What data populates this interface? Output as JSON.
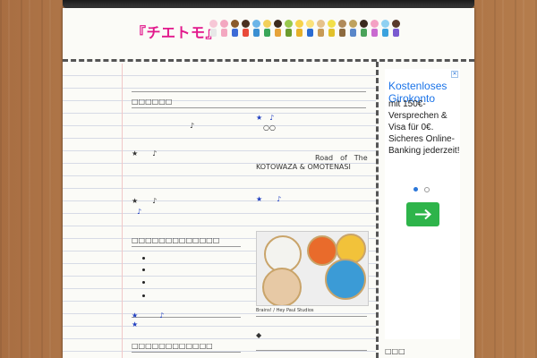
{
  "header": {
    "logo_text": "『チエトモ』"
  },
  "main": {
    "section1_heading": "□□□□□□",
    "notes_left": [
      {
        "text": "♪"
      },
      {
        "text": "★　　♪"
      },
      {
        "text": "★　　♪"
      },
      {
        "text": "♪"
      }
    ],
    "notes_right": [
      {
        "text": "★　♪"
      },
      {
        "text": "○○"
      },
      {
        "text": "Road　of　The"
      },
      {
        "text": "KOTOWAZA & OMOTENASI"
      },
      {
        "text": "★　　♪"
      }
    ],
    "section2_heading": "□□□□□□□□□□□□□",
    "bullet_count": 4,
    "section2_notes": [
      {
        "text": "★　　　♪"
      },
      {
        "text": "★"
      }
    ],
    "photo_caption": "Brains! / Hey Paul Studios",
    "diamond": "◆",
    "section3_heading": "□□□□□□□□□□□□"
  },
  "ad": {
    "headline": "Kostenloses Girokonto",
    "body": "mit 150€-Versprechen & Visa für 0€. Sicheres Online-Banking jederzeit!",
    "close_glyph": "✕",
    "arrow_glyph": "→",
    "cta_color": "#2eb44a",
    "headline_color": "#1a73e8"
  },
  "sidebar": {
    "bottom_heading": "□□□"
  }
}
